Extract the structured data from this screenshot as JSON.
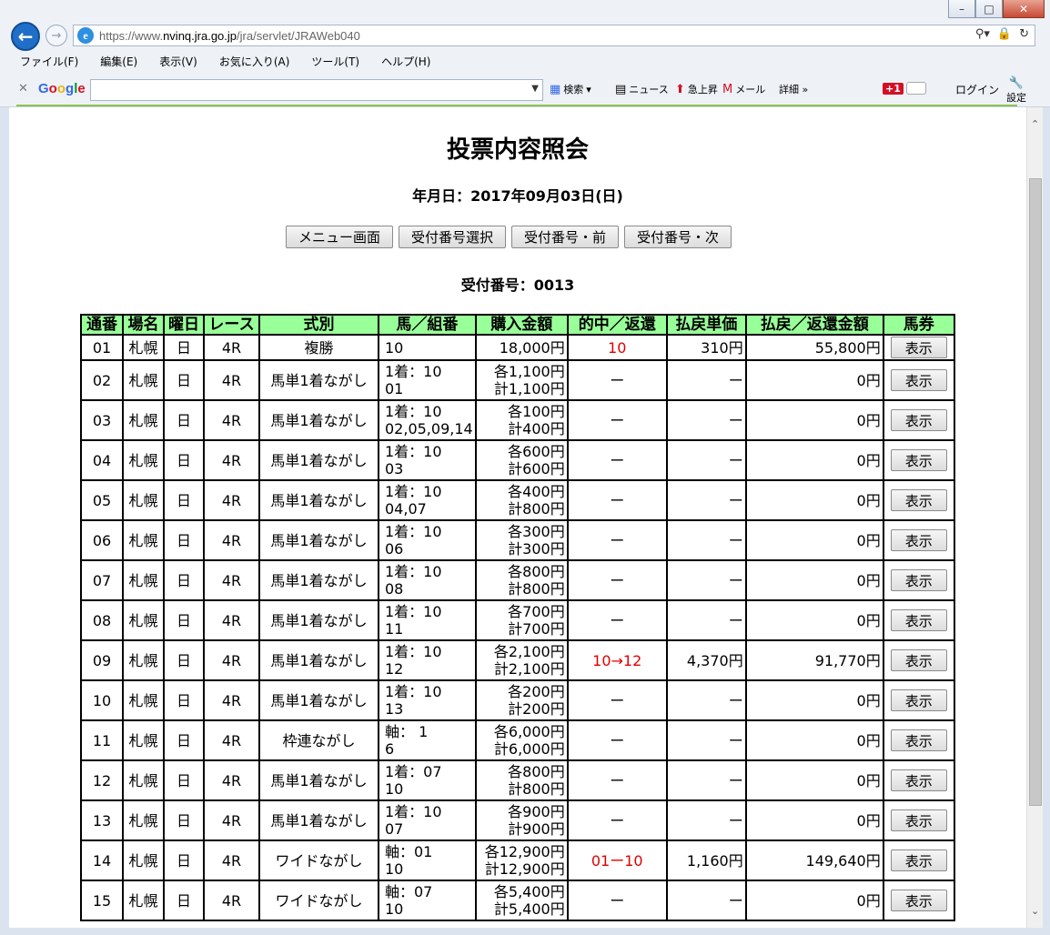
{
  "browser": {
    "url_prefix": "https://www.",
    "url_host": "nvinq.jra.go.jp",
    "url_path": "/jra/servlet/JRAWeb040",
    "menu": [
      "ファイル(F)",
      "編集(E)",
      "表示(V)",
      "お気に入り(A)",
      "ツール(T)",
      "ヘルプ(H)"
    ],
    "google_toolbar": {
      "logo": [
        "G",
        "o",
        "o",
        "g",
        "l",
        "e"
      ],
      "search_label": "検索",
      "news_label": "ニュース",
      "rising_label": "急上昇",
      "mail_label": "メール",
      "detail_label": "詳細 »",
      "gplus_label": "+1",
      "login_label": "ログイン",
      "settings_label": "設定"
    }
  },
  "page": {
    "title": "投票内容照会",
    "date_line": "年月日：2017年09月03日(日)",
    "buttons": [
      "メニュー画面",
      "受付番号選択",
      "受付番号・前",
      "受付番号・次"
    ],
    "receipt_line": "受付番号：0013"
  },
  "table": {
    "headers": [
      "通番",
      "場名",
      "曜日",
      "レース",
      "式別",
      "馬／組番",
      "購入金額",
      "的中／返還",
      "払戻単価",
      "払戻／返還金額",
      "馬券"
    ],
    "show_label": "表示",
    "rows": [
      {
        "no": "01",
        "venue": "札幌",
        "day": "日",
        "race": "4R",
        "type": "複勝",
        "combo": [
          "10"
        ],
        "amount": [
          "18,000円"
        ],
        "hit": "10",
        "unit": "310円",
        "payout": "55,800円"
      },
      {
        "no": "02",
        "venue": "札幌",
        "day": "日",
        "race": "4R",
        "type": "馬単1着ながし",
        "combo": [
          "1着：10",
          "01"
        ],
        "amount": [
          "各1,100円",
          "計1,100円"
        ],
        "hit": "ー",
        "unit": "ー",
        "payout": "0円"
      },
      {
        "no": "03",
        "venue": "札幌",
        "day": "日",
        "race": "4R",
        "type": "馬単1着ながし",
        "combo": [
          "1着：10",
          "02,05,09,14"
        ],
        "amount": [
          "各100円",
          "計400円"
        ],
        "hit": "ー",
        "unit": "ー",
        "payout": "0円"
      },
      {
        "no": "04",
        "venue": "札幌",
        "day": "日",
        "race": "4R",
        "type": "馬単1着ながし",
        "combo": [
          "1着：10",
          "03"
        ],
        "amount": [
          "各600円",
          "計600円"
        ],
        "hit": "ー",
        "unit": "ー",
        "payout": "0円"
      },
      {
        "no": "05",
        "venue": "札幌",
        "day": "日",
        "race": "4R",
        "type": "馬単1着ながし",
        "combo": [
          "1着：10",
          "04,07"
        ],
        "amount": [
          "各400円",
          "計800円"
        ],
        "hit": "ー",
        "unit": "ー",
        "payout": "0円"
      },
      {
        "no": "06",
        "venue": "札幌",
        "day": "日",
        "race": "4R",
        "type": "馬単1着ながし",
        "combo": [
          "1着：10",
          "06"
        ],
        "amount": [
          "各300円",
          "計300円"
        ],
        "hit": "ー",
        "unit": "ー",
        "payout": "0円"
      },
      {
        "no": "07",
        "venue": "札幌",
        "day": "日",
        "race": "4R",
        "type": "馬単1着ながし",
        "combo": [
          "1着：10",
          "08"
        ],
        "amount": [
          "各800円",
          "計800円"
        ],
        "hit": "ー",
        "unit": "ー",
        "payout": "0円"
      },
      {
        "no": "08",
        "venue": "札幌",
        "day": "日",
        "race": "4R",
        "type": "馬単1着ながし",
        "combo": [
          "1着：10",
          "11"
        ],
        "amount": [
          "各700円",
          "計700円"
        ],
        "hit": "ー",
        "unit": "ー",
        "payout": "0円"
      },
      {
        "no": "09",
        "venue": "札幌",
        "day": "日",
        "race": "4R",
        "type": "馬単1着ながし",
        "combo": [
          "1着：10",
          "12"
        ],
        "amount": [
          "各2,100円",
          "計2,100円"
        ],
        "hit": "10→12",
        "unit": "4,370円",
        "payout": "91,770円"
      },
      {
        "no": "10",
        "venue": "札幌",
        "day": "日",
        "race": "4R",
        "type": "馬単1着ながし",
        "combo": [
          "1着：10",
          "13"
        ],
        "amount": [
          "各200円",
          "計200円"
        ],
        "hit": "ー",
        "unit": "ー",
        "payout": "0円"
      },
      {
        "no": "11",
        "venue": "札幌",
        "day": "日",
        "race": "4R",
        "type": "枠連ながし",
        "combo": [
          "軸： 1",
          " 6"
        ],
        "amount": [
          "各6,000円",
          "計6,000円"
        ],
        "hit": "ー",
        "unit": "ー",
        "payout": "0円"
      },
      {
        "no": "12",
        "venue": "札幌",
        "day": "日",
        "race": "4R",
        "type": "馬単1着ながし",
        "combo": [
          "1着：07",
          "10"
        ],
        "amount": [
          "各800円",
          "計800円"
        ],
        "hit": "ー",
        "unit": "ー",
        "payout": "0円"
      },
      {
        "no": "13",
        "venue": "札幌",
        "day": "日",
        "race": "4R",
        "type": "馬単1着ながし",
        "combo": [
          "1着：10",
          "07"
        ],
        "amount": [
          "各900円",
          "計900円"
        ],
        "hit": "ー",
        "unit": "ー",
        "payout": "0円"
      },
      {
        "no": "14",
        "venue": "札幌",
        "day": "日",
        "race": "4R",
        "type": "ワイドながし",
        "combo": [
          "軸：01",
          "10"
        ],
        "amount": [
          "各12,900円",
          "計12,900円"
        ],
        "hit": "01ー10",
        "unit": "1,160円",
        "payout": "149,640円"
      },
      {
        "no": "15",
        "venue": "札幌",
        "day": "日",
        "race": "4R",
        "type": "ワイドながし",
        "combo": [
          "軸：07",
          "10"
        ],
        "amount": [
          "各5,400円",
          "計5,400円"
        ],
        "hit": "ー",
        "unit": "ー",
        "payout": "0円"
      }
    ]
  },
  "colors": {
    "header_bg": "#99ff99",
    "hit_text": "#e00000",
    "accent_line": "#8bc34a"
  }
}
